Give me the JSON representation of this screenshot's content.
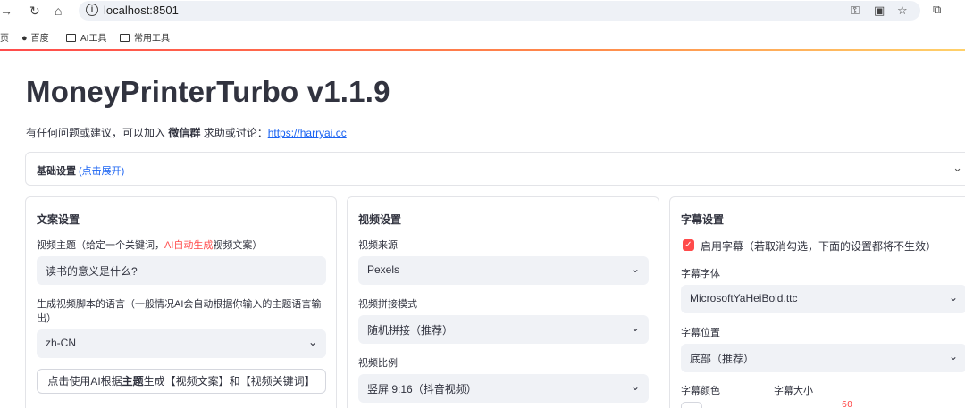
{
  "browser": {
    "url": "localhost:8501",
    "bookmarks": [
      {
        "label": "页",
        "icon": "none"
      },
      {
        "label": "百度",
        "icon": "globe-icon"
      },
      {
        "label": "AI工具",
        "icon": "folder-icon"
      },
      {
        "label": "常用工具",
        "icon": "folder-icon"
      }
    ]
  },
  "app": {
    "title": "MoneyPrinterTurbo v1.1.9",
    "subtitle_prefix": "有任何问题或建议，可以加入 ",
    "subtitle_bold": "微信群",
    "subtitle_mid": " 求助或讨论：",
    "subtitle_link": "https://harryai.cc",
    "accent_color": "#ff4b4b"
  },
  "basic_settings": {
    "label": "基础设置",
    "hint": "(点击展开)"
  },
  "script_panel": {
    "title": "文案设置",
    "topic_label_prefix": "视频主题（给定一个关键词，",
    "topic_label_red": "AI自动生成",
    "topic_label_suffix": "视频文案）",
    "topic_value": "读书的意义是什么?",
    "language_label": "生成视频脚本的语言（一般情况AI会自动根据你输入的主题语言输出）",
    "language_value": "zh-CN",
    "generate_button_prefix": "点击使用AI根据",
    "generate_button_bold": "主题",
    "generate_button_suffix": "生成【视频文案】和【视频关键词】"
  },
  "video_panel": {
    "title": "视频设置",
    "source_label": "视频来源",
    "source_value": "Pexels",
    "concat_label": "视频拼接模式",
    "concat_value": "随机拼接（推荐）",
    "ratio_label": "视频比例",
    "ratio_value": "竖屏 9:16（抖音视频）"
  },
  "subtitle_panel": {
    "title": "字幕设置",
    "enable_label": "启用字幕（若取消勾选，下面的设置都将不生效）",
    "enabled": true,
    "font_label": "字幕字体",
    "font_value": "MicrosoftYaHeiBold.ttc",
    "position_label": "字幕位置",
    "position_value": "底部（推荐）",
    "color_label": "字幕颜色",
    "size_label": "字幕大小",
    "size_value": "60"
  }
}
